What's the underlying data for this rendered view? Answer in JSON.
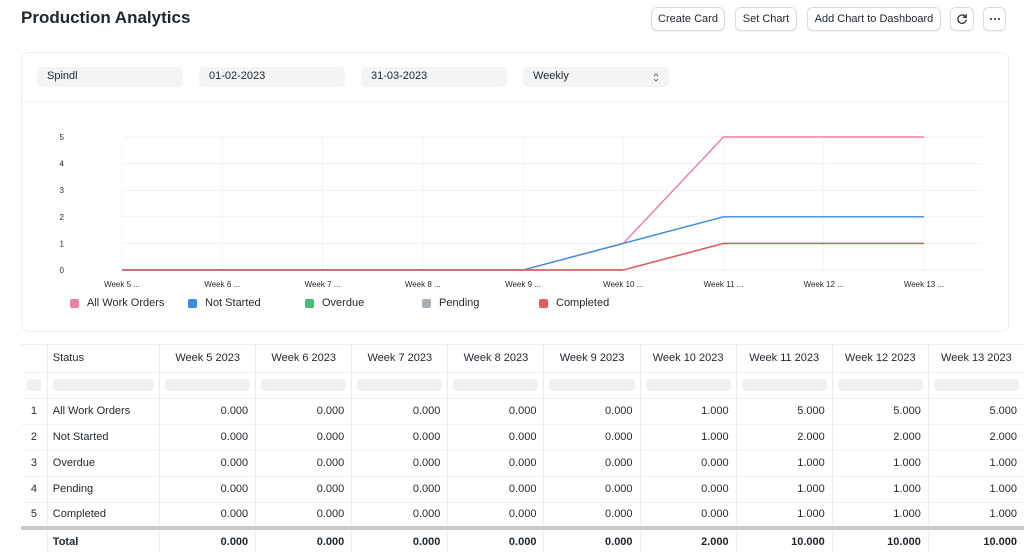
{
  "page_title": "Production Analytics",
  "toolbar": {
    "create_card": "Create Card",
    "set_chart": "Set Chart",
    "add_to_dashboard": "Add Chart to Dashboard"
  },
  "filters": {
    "company": "Spindl",
    "from_date": "01-02-2023",
    "to_date": "31-03-2023",
    "range": "Weekly"
  },
  "chart_data": {
    "type": "line",
    "categories": [
      "Week 5 ...",
      "Week 6 ...",
      "Week 7 ...",
      "Week 8 ...",
      "Week 9 ...",
      "Week 10 ...",
      "Week 11 ...",
      "Week 12 ...",
      "Week 13 ..."
    ],
    "yticks": [
      "0",
      "1",
      "2",
      "3",
      "4",
      "5"
    ],
    "ylim": [
      0,
      5
    ],
    "grid": true,
    "legend_position": "bottom-left",
    "series": [
      {
        "name": "All Work Orders",
        "color": "#ec7fa2",
        "values": [
          0,
          0,
          0,
          0,
          0,
          1,
          5,
          5,
          5
        ]
      },
      {
        "name": "Not Started",
        "color": "#3a8be2",
        "values": [
          0,
          0,
          0,
          0,
          0,
          1,
          2,
          2,
          2
        ]
      },
      {
        "name": "Overdue",
        "color": "#48bb74",
        "values": [
          0,
          0,
          0,
          0,
          0,
          0,
          1,
          1,
          1
        ]
      },
      {
        "name": "Pending",
        "color": "#a6b0b8",
        "values": [
          0,
          0,
          0,
          0,
          0,
          0,
          1,
          1,
          1
        ]
      },
      {
        "name": "Completed",
        "color": "#e65c5c",
        "values": [
          0,
          0,
          0,
          0,
          0,
          0,
          1,
          1,
          1
        ]
      }
    ]
  },
  "table": {
    "status_header": "Status",
    "columns": [
      "Week 5 2023",
      "Week 6 2023",
      "Week 7 2023",
      "Week 8 2023",
      "Week 9 2023",
      "Week 10 2023",
      "Week 11 2023",
      "Week 12 2023",
      "Week 13 2023"
    ],
    "rows": [
      {
        "index": "1",
        "status": "All Work Orders",
        "values": [
          "0.000",
          "0.000",
          "0.000",
          "0.000",
          "0.000",
          "1.000",
          "5.000",
          "5.000",
          "5.000"
        ]
      },
      {
        "index": "2",
        "status": "Not Started",
        "values": [
          "0.000",
          "0.000",
          "0.000",
          "0.000",
          "0.000",
          "1.000",
          "2.000",
          "2.000",
          "2.000"
        ]
      },
      {
        "index": "3",
        "status": "Overdue",
        "values": [
          "0.000",
          "0.000",
          "0.000",
          "0.000",
          "0.000",
          "0.000",
          "1.000",
          "1.000",
          "1.000"
        ]
      },
      {
        "index": "4",
        "status": "Pending",
        "values": [
          "0.000",
          "0.000",
          "0.000",
          "0.000",
          "0.000",
          "0.000",
          "1.000",
          "1.000",
          "1.000"
        ]
      },
      {
        "index": "5",
        "status": "Completed",
        "values": [
          "0.000",
          "0.000",
          "0.000",
          "0.000",
          "0.000",
          "0.000",
          "1.000",
          "1.000",
          "1.000"
        ]
      }
    ],
    "total_label": "Total",
    "totals": [
      "0.000",
      "0.000",
      "0.000",
      "0.000",
      "0.000",
      "2.000",
      "10.000",
      "10.000",
      "10.000"
    ]
  }
}
